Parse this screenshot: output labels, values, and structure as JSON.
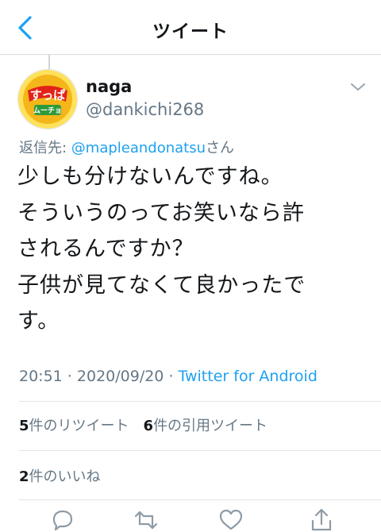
{
  "header": {
    "title": "ツイート"
  },
  "tweet": {
    "name": "naga",
    "handle": "@dankichi268",
    "reply_prefix": "返信先: ",
    "reply_to": "@mapleandonatsu",
    "reply_suffix": "さん",
    "lines": [
      "少しも分けないんですね。",
      "そういうのってお笑いなら許",
      "されるんですか？",
      "子供が見てなくて良かったで",
      "す。"
    ],
    "time": "20:51",
    "sep1": " · ",
    "date": "2020/09/20",
    "sep2": " · ",
    "source": "Twitter for Android"
  },
  "stats": {
    "retweets_count": "5",
    "retweets_label": "件のリツイート",
    "quotes_count": "6",
    "quotes_label": "件の引用ツイート",
    "likes_count": "2",
    "likes_label": "件のいいね"
  },
  "avatar_logo": {
    "text_main": "すっぱ",
    "text_sub": "ムーチョ",
    "bg": "#f4b61a",
    "ring": "#ffe15a",
    "red": "#e2231a"
  },
  "colors": {
    "accent": "#1da1f2",
    "secondary": "#657786",
    "divider": "#e1e6ea"
  },
  "icons": [
    "back-chevron-icon",
    "chevron-down-icon",
    "reply-icon",
    "retweet-icon",
    "like-icon",
    "share-icon"
  ]
}
